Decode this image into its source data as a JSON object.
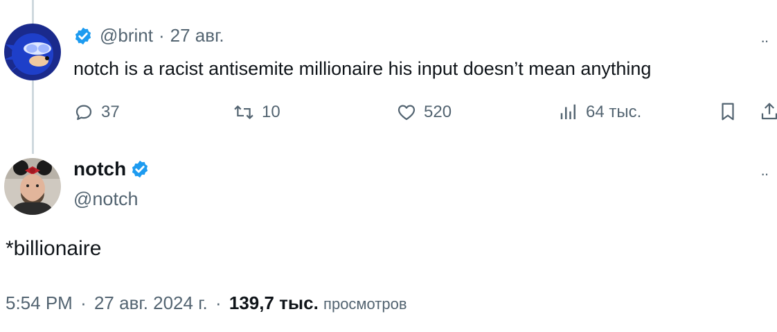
{
  "parent_tweet": {
    "handle": "@brint",
    "separator": "·",
    "date": "27 авг.",
    "text": "notch is a racist antisemite millionaire his input doesn’t mean anything",
    "more": "··",
    "actions": {
      "replies": "37",
      "retweets": "10",
      "likes": "520",
      "views": "64 тыс."
    }
  },
  "reply_tweet": {
    "name": "notch",
    "handle": "@notch",
    "more": "··",
    "text": "*billionaire",
    "time": "5:54 PM",
    "separator1": "·",
    "date": "27 авг. 2024 г.",
    "separator2": "·",
    "views_count": "139,7 тыс.",
    "views_label": "просмотров"
  },
  "colors": {
    "verified": "#1d9bf0",
    "secondary_text": "#536471",
    "primary_text": "#0f1419",
    "thread_line": "#cfd9de"
  }
}
